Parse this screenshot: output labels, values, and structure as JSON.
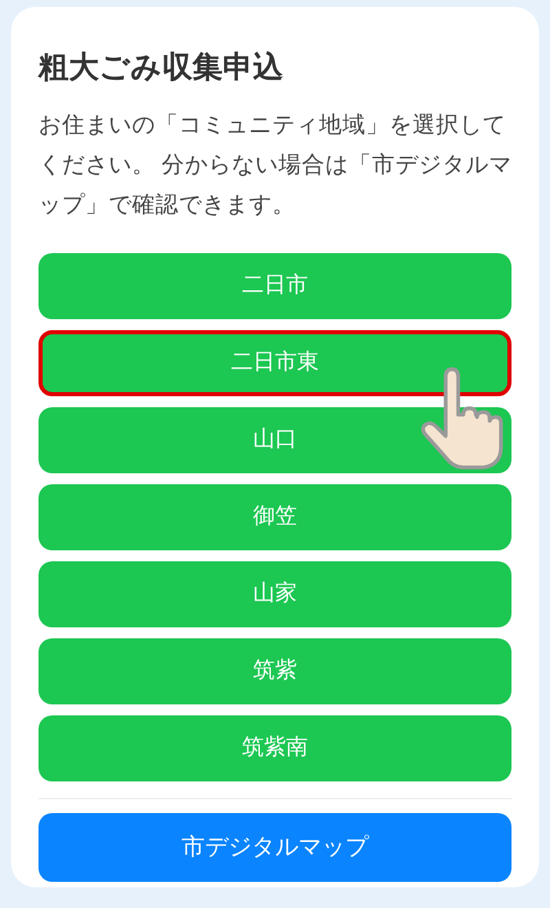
{
  "title": "粗大ごみ収集申込",
  "description": "お住まいの「コミュニティ地域」を選択してください。 分からない場合は「市デジタルマップ」で確認できます。",
  "areas": [
    {
      "label": "二日市",
      "selected": false
    },
    {
      "label": "二日市東",
      "selected": true
    },
    {
      "label": "山口",
      "selected": false
    },
    {
      "label": "御笠",
      "selected": false
    },
    {
      "label": "山家",
      "selected": false
    },
    {
      "label": "筑紫",
      "selected": false
    },
    {
      "label": "筑紫南",
      "selected": false
    }
  ],
  "map_button": {
    "label": "市デジタルマップ"
  }
}
